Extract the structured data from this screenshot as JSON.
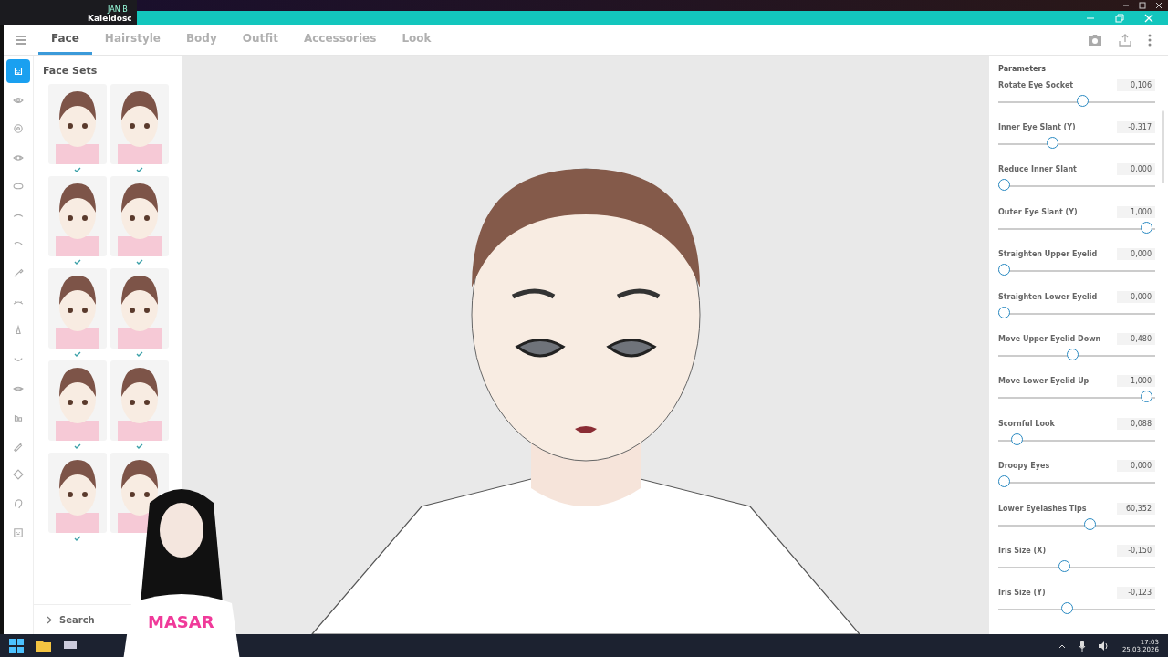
{
  "background_window": {
    "channel": "JAN B",
    "title": "Kaleidosc"
  },
  "tabs": [
    {
      "label": "Face",
      "selected": true
    },
    {
      "label": "Hairstyle",
      "selected": false
    },
    {
      "label": "Body",
      "selected": false
    },
    {
      "label": "Outfit",
      "selected": false
    },
    {
      "label": "Accessories",
      "selected": false
    },
    {
      "label": "Look",
      "selected": false
    }
  ],
  "category_rail": [
    {
      "selected": true
    },
    {
      "selected": false
    },
    {
      "selected": false
    },
    {
      "selected": false
    },
    {
      "selected": false
    },
    {
      "selected": false
    },
    {
      "selected": false
    },
    {
      "selected": false
    },
    {
      "selected": false
    },
    {
      "selected": false
    },
    {
      "selected": false
    },
    {
      "selected": false
    },
    {
      "selected": false
    },
    {
      "selected": false
    },
    {
      "selected": false
    },
    {
      "selected": false
    },
    {
      "selected": false
    }
  ],
  "face_sets": {
    "title": "Face Sets",
    "items": [
      {
        "checked": true
      },
      {
        "checked": true
      },
      {
        "checked": true
      },
      {
        "checked": true
      },
      {
        "checked": true
      },
      {
        "checked": true
      },
      {
        "checked": true
      },
      {
        "checked": true
      },
      {
        "checked": true
      },
      {
        "checked": false
      }
    ],
    "search": "Search"
  },
  "overlay": {
    "shirt_text": "MASAR"
  },
  "parameters": {
    "title": "Parameters",
    "sliders": [
      {
        "label": "Rotate Eye Socket",
        "value": "0,106",
        "level": 0.55
      },
      {
        "label": "Inner Eye Slant (Y)",
        "value": "-0,317",
        "level": 0.34
      },
      {
        "label": "Reduce Inner Slant",
        "value": "0,000",
        "level": 0
      },
      {
        "label": "Outer Eye Slant (Y)",
        "value": "1,000",
        "level": 1
      },
      {
        "label": "Straighten Upper Eyelid",
        "value": "0,000",
        "level": 0
      },
      {
        "label": "Straighten Lower Eyelid",
        "value": "0,000",
        "level": 0
      },
      {
        "label": "Move Upper Eyelid Down",
        "value": "0,480",
        "level": 0.48
      },
      {
        "label": "Move Lower Eyelid Up",
        "value": "1,000",
        "level": 1
      },
      {
        "label": "Scornful Look",
        "value": "0,088",
        "level": 0.088
      },
      {
        "label": "Droopy Eyes",
        "value": "0,000",
        "level": 0
      },
      {
        "label": "Lower Eyelashes Tips",
        "value": "60,352",
        "level": 0.6
      },
      {
        "label": "Iris Size (X)",
        "value": "-0,150",
        "level": 0.425
      },
      {
        "label": "Iris Size (Y)",
        "value": "-0,123",
        "level": 0.44
      }
    ]
  },
  "taskbar": {
    "time": "17:03",
    "date": "25.03.2026"
  }
}
